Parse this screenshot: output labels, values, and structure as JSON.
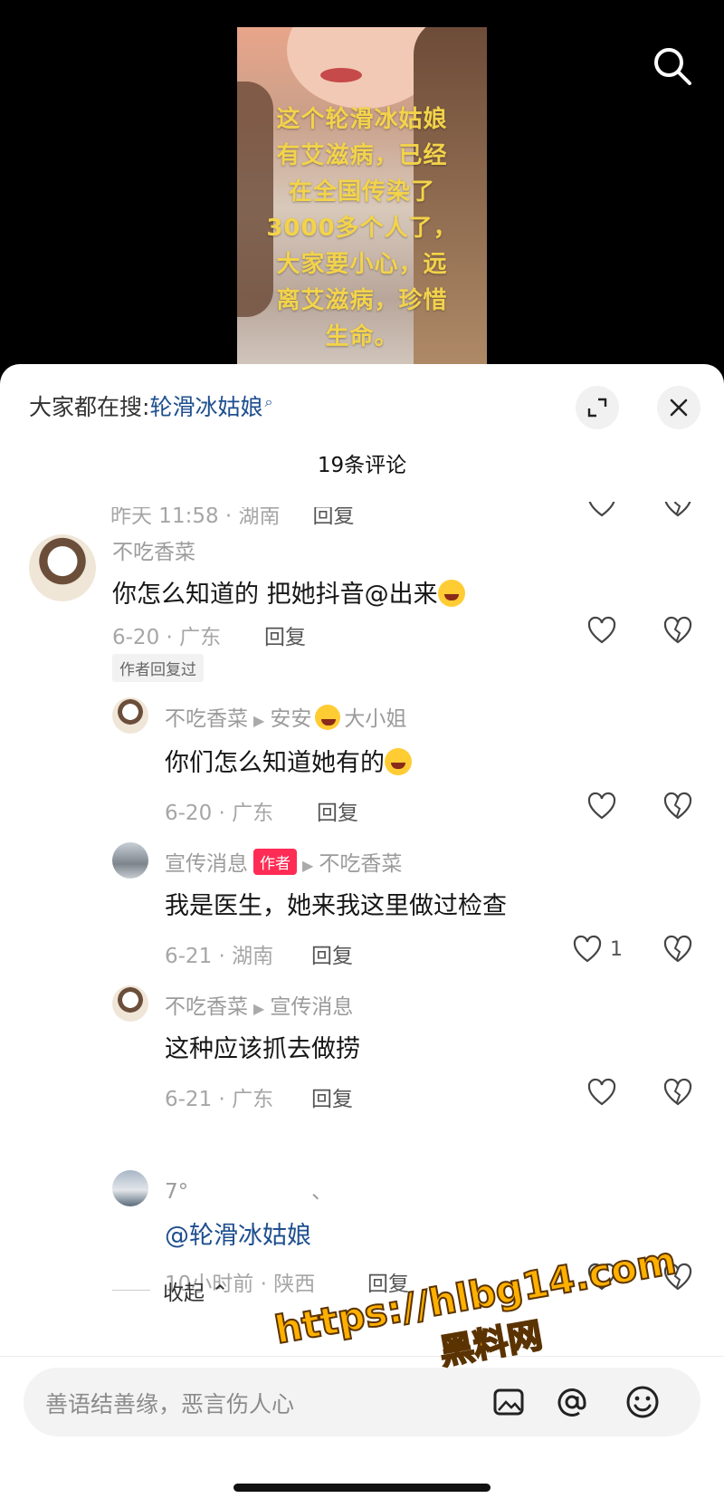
{
  "video": {
    "caption_lines": [
      "这个轮滑冰姑娘",
      "有艾滋病，已经",
      "在全国传染了",
      "3000多个人了，",
      "大家要小心，远",
      "离艾滋病，珍惜",
      "生命。"
    ]
  },
  "header": {
    "search_prefix": "大家都在搜:",
    "search_keyword": "轮滑冰姑娘",
    "comment_count": "19条评论"
  },
  "ghost_row": {
    "meta": "昨天 11:58 · 湖南",
    "reply": "回复"
  },
  "comments": [
    {
      "user": "不吃香菜",
      "text": "你怎么知道的 把她抖音@出来",
      "date": "6-20",
      "location": "广东",
      "reply": "回复",
      "tag": "作者回复过"
    },
    {
      "user": "不吃香菜",
      "reply_to": "安安",
      "reply_to_suffix": "大小姐",
      "text": "你们怎么知道她有的",
      "date": "6-20",
      "location": "广东",
      "reply": "回复"
    },
    {
      "user": "宣传消息",
      "badge": "作者",
      "reply_to": "不吃香菜",
      "text": "我是医生，她来我这里做过检查",
      "date": "6-21",
      "location": "湖南",
      "reply": "回复",
      "likes": "1"
    },
    {
      "user": "不吃香菜",
      "reply_to": "宣传消息",
      "text": "这种应该抓去做捞",
      "date": "6-21",
      "location": "广东",
      "reply": "回复"
    },
    {
      "user": "7°",
      "user_suffix": "、",
      "text": "@轮滑冰姑娘",
      "date": "10小时前",
      "location": "陕西",
      "reply": "回复"
    }
  ],
  "collapse_label": "收起",
  "input": {
    "placeholder": "善语结善缘，恶言伤人心"
  },
  "watermark": {
    "line1": "https://hlbg14.com",
    "line2": "黑料网"
  },
  "colors": {
    "accent_red": "#fe2c55",
    "link_blue": "#1e4f8f",
    "watermark": "#ffb000"
  }
}
